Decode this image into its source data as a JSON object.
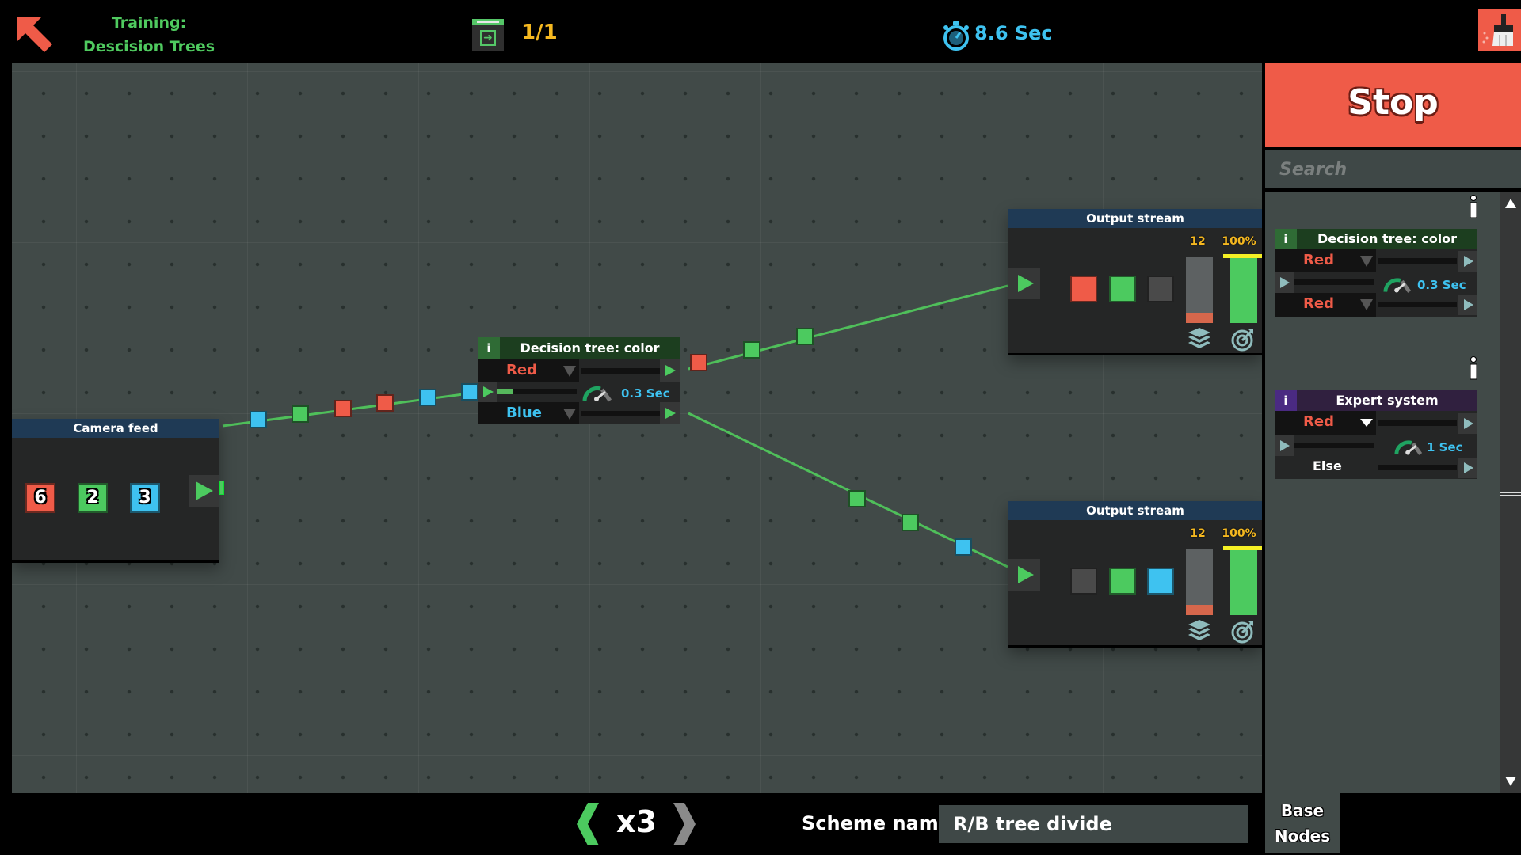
{
  "header": {
    "title": "Training: Descision Trees",
    "level_count": "1/1",
    "timer": "8.6 Sec"
  },
  "colors": {
    "red": "#ef5b48",
    "green": "#4cca5f",
    "blue": "#3ec2f0",
    "gray": "#4a4a4a",
    "accent_text": "#4fca5f",
    "count_text": "#f5b820",
    "wire": "#4fbf5a"
  },
  "canvas": {
    "camera_feed": {
      "title": "Camera feed",
      "chips": [
        {
          "color": "red",
          "count": "6"
        },
        {
          "color": "green",
          "count": "2"
        },
        {
          "color": "blue",
          "count": "3"
        }
      ]
    },
    "decision_node": {
      "info": "i",
      "title": "Decision tree: color",
      "option_top": "Red",
      "option_bottom": "Blue",
      "speed": "0.3 Sec",
      "input_progress": 0.2
    },
    "output_streams": [
      {
        "title": "Output stream",
        "slots": [
          "red",
          "green",
          "gray"
        ],
        "count": "12",
        "count_fill": 0.15,
        "accuracy": "100%",
        "accuracy_fill": 1.0
      },
      {
        "title": "Output stream",
        "slots": [
          "gray",
          "green",
          "blue"
        ],
        "count": "12",
        "count_fill": 0.15,
        "accuracy": "100%",
        "accuracy_fill": 1.0
      }
    ],
    "packets_in": [
      "blue",
      "green",
      "red",
      "red",
      "blue",
      "blue"
    ],
    "packets_top": [
      "red",
      "green",
      "green"
    ],
    "packets_bottom": [
      "green",
      "green",
      "blue"
    ]
  },
  "panel": {
    "stop_label": "Stop",
    "search_placeholder": "Search",
    "palette": [
      {
        "title": "Decision tree: color",
        "info": "i",
        "option_top": "Red",
        "option_bottom": "Red",
        "speed": "0.3 Sec"
      },
      {
        "title": "Expert system",
        "info": "i",
        "option_top": "Red",
        "option_bottom": "Else",
        "speed": "1 Sec"
      }
    ],
    "tab_label_1": "Base",
    "tab_label_2": "Nodes"
  },
  "footer": {
    "speed_multiplier": "x3",
    "scheme_label": "Scheme name :",
    "scheme_name": "R/B tree divide"
  }
}
